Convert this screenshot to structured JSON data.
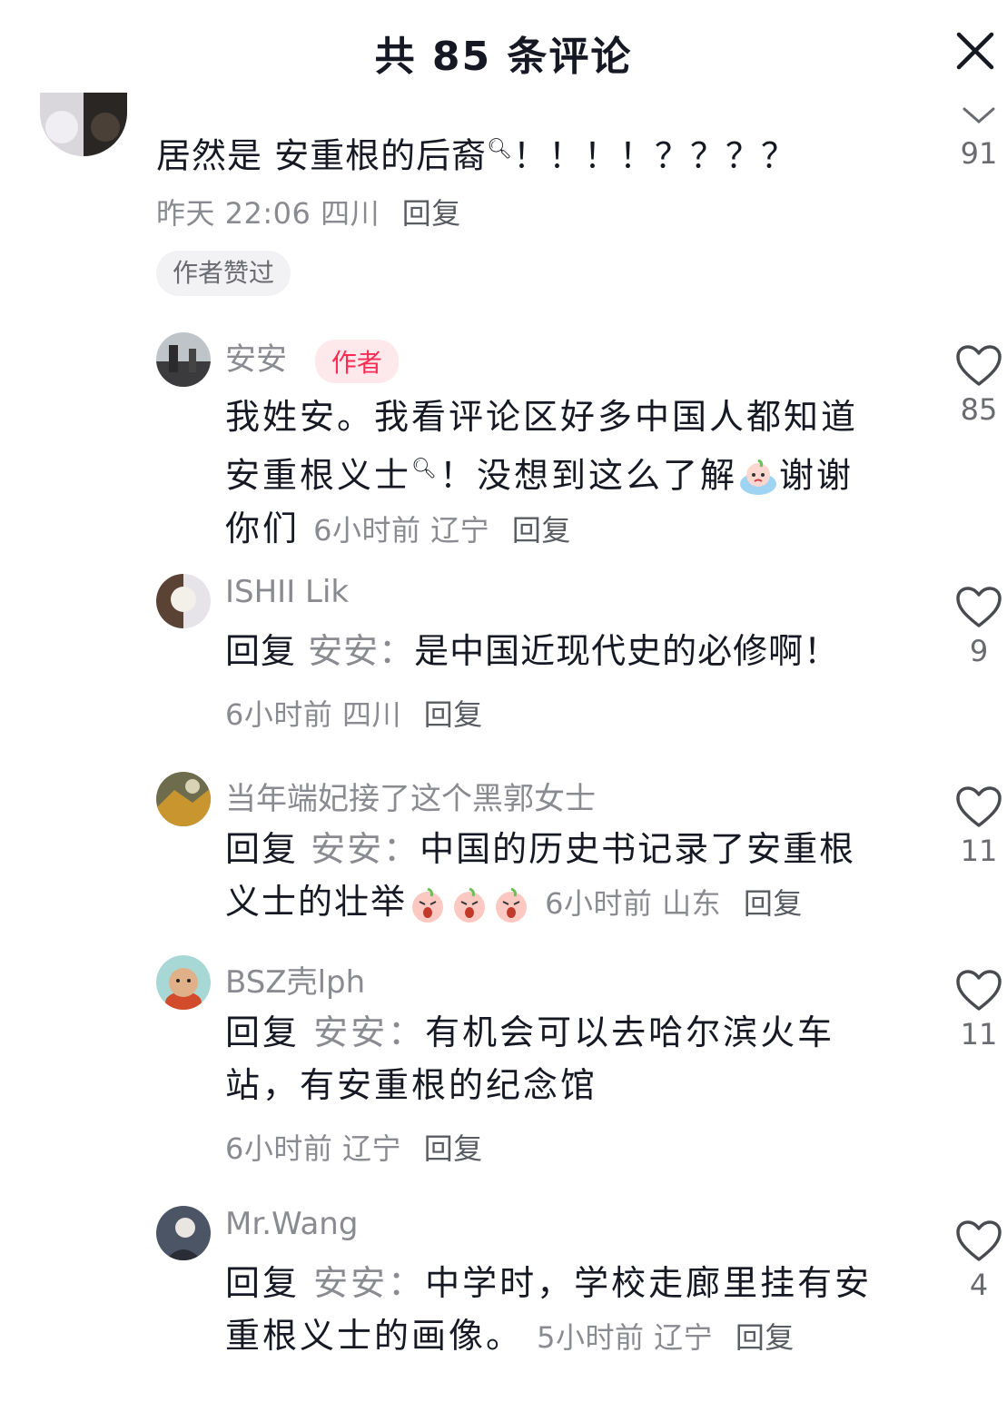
{
  "header": {
    "title": "共 85 条评论"
  },
  "top_comment": {
    "text_before": "居然是 安重根的后裔",
    "text_after": "！！！！？？？？",
    "time": "昨天 22:06",
    "location": "四川",
    "reply_label": "回复",
    "liked_tag": "作者赞过",
    "like_count": "91"
  },
  "replies": [
    {
      "username": "安安",
      "badge": "作者",
      "line1": "我姓安。我看评论区好多中国人都知道",
      "line2_a": "安重根义士",
      "line2_b": "！没想到这么了解",
      "line2_c": "谢谢",
      "line3": "你们",
      "time": "6小时前",
      "location": "辽宁",
      "reply_label": "回复",
      "like_count": "85"
    },
    {
      "username": "ISHII Lik",
      "reply_prefix": "回复",
      "reply_to": "安安：",
      "text": "是中国近现代史的必修啊！",
      "time": "6小时前",
      "location": "四川",
      "reply_label": "回复",
      "like_count": "9"
    },
    {
      "username": "当年端妃接了这个黑郭女士",
      "reply_prefix": "回复",
      "reply_to": "安安：",
      "line1": "中国的历史书记录了安重根",
      "line2": "义士的壮举",
      "time": "6小时前",
      "location": "山东",
      "reply_label": "回复",
      "like_count": "11"
    },
    {
      "username": "BSZ壳lph",
      "reply_prefix": "回复",
      "reply_to": "安安：",
      "line1": "有机会可以去哈尔滨火车",
      "line2": "站，有安重根的纪念馆",
      "time": "6小时前",
      "location": "辽宁",
      "reply_label": "回复",
      "like_count": "11"
    },
    {
      "username": "Mr.Wang",
      "reply_prefix": "回复",
      "reply_to": "安安：",
      "line1": "中学时，学校走廊里挂有安",
      "line2": "重根义士的画像。",
      "time": "5小时前",
      "location": "辽宁",
      "reply_label": "回复",
      "like_count": "4"
    }
  ],
  "icons": {
    "close": "close-icon",
    "heart": "heart-outline-icon",
    "chevron": "chevron-down-icon",
    "search": "search-icon",
    "emoji_cry": "crying-emoji-icon",
    "emoji_angry": "angry-peach-emoji-icon"
  }
}
